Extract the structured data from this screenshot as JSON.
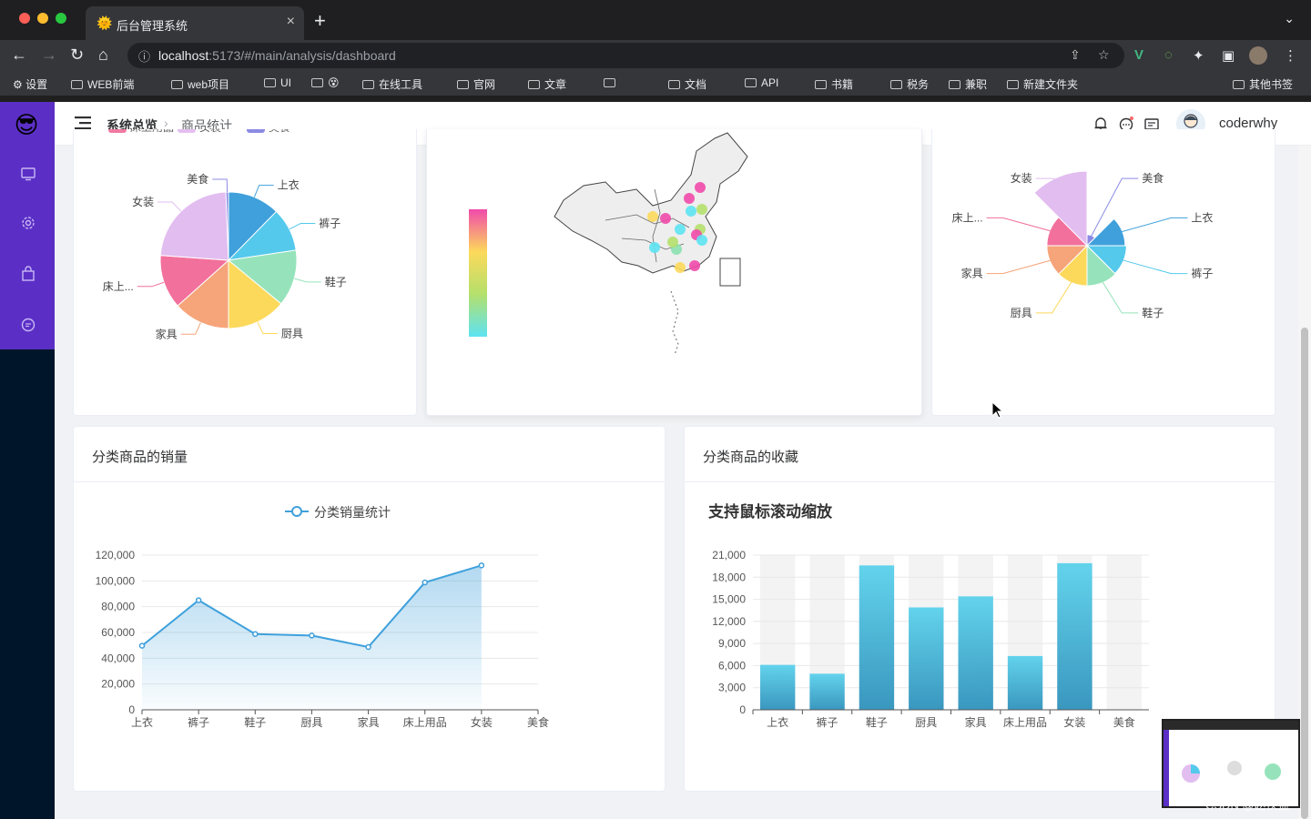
{
  "browser": {
    "tab_title": "后台管理系统",
    "url_host": "localhost",
    "url_rest": ":5173/#/main/analysis/dashboard",
    "bookmarks": [
      "设置",
      "WEB前端",
      "web项目",
      "UI",
      "😵",
      "在线工具",
      "官网",
      "文章",
      "",
      "文档",
      "API",
      "书籍",
      "税务",
      "兼职",
      "新建文件夹"
    ],
    "other_bookmarks": "其他书签"
  },
  "header": {
    "breadcrumb_1": "系统总览",
    "breadcrumb_2": "商品统计",
    "username": "coderwhy"
  },
  "sales_card": {
    "title": "分类商品的销量"
  },
  "favor_card": {
    "title": "分类商品的收藏"
  },
  "watermark": "CSDN @赵侠益",
  "chart_data": [
    {
      "type": "pie",
      "categories": [
        "上衣",
        "裤子",
        "鞋子",
        "厨具",
        "家具",
        "床上...",
        "女装",
        "美食"
      ],
      "values": [
        6000,
        5000,
        6500,
        6800,
        6500,
        6200,
        11300,
        300
      ],
      "legend": [
        "床上用品",
        "女装",
        "美食"
      ],
      "legend_colors": [
        "#f07aa1",
        "#e4bff0",
        "#8b8be5"
      ],
      "colors": [
        "#3fa0db",
        "#54c9ec",
        "#96e3bb",
        "#fcd95b",
        "#f6a47a",
        "#f2709c",
        "#e2bdf0",
        "#8b8be5"
      ]
    },
    {
      "type": "map",
      "visual_map_colors": [
        "#f04aaa",
        "#fcd95b",
        "#b4e06c",
        "#5de3f2"
      ],
      "points": [
        {
          "c": "#f04aaa"
        },
        {
          "c": "#f04aaa"
        },
        {
          "c": "#b4e06c"
        },
        {
          "c": "#5de3f2"
        },
        {
          "c": "#fcd95b"
        },
        {
          "c": "#f04aaa"
        },
        {
          "c": "#5de3f2"
        },
        {
          "c": "#b4e06c"
        },
        {
          "c": "#f04aaa"
        },
        {
          "c": "#5de3f2"
        },
        {
          "c": "#8be0b0"
        },
        {
          "c": "#b4e06c"
        },
        {
          "c": "#5de3f2"
        },
        {
          "c": "#f04aaa"
        },
        {
          "c": "#fcd95b"
        }
      ]
    },
    {
      "type": "rose",
      "categories": [
        "女装",
        "美食",
        "上衣",
        "裤子",
        "鞋子",
        "厨具",
        "家具",
        "床上..."
      ],
      "values": [
        95,
        3,
        42,
        44,
        45,
        45,
        45,
        45
      ],
      "colors": [
        "#e2bdf0",
        "#8b8be5",
        "#3fa0db",
        "#54c9ec",
        "#96e3bb",
        "#fcd95b",
        "#f6a47a",
        "#f2709c"
      ]
    },
    {
      "type": "line",
      "legend": "分类销量统计",
      "categories": [
        "上衣",
        "裤子",
        "鞋子",
        "厨具",
        "家具",
        "床上用品",
        "女装",
        "美食"
      ],
      "values": [
        49700,
        85000,
        58800,
        57600,
        48700,
        98800,
        112000,
        null
      ],
      "yticks": [
        "120,000",
        "100,000",
        "80,000",
        "60,000",
        "40,000",
        "20,000",
        "0"
      ],
      "ylim": [
        0,
        120000
      ],
      "color": "#3fa0db"
    },
    {
      "type": "bar",
      "title": "支持鼠标滚动缩放",
      "categories": [
        "上衣",
        "裤子",
        "鞋子",
        "厨具",
        "家具",
        "床上用品",
        "女装",
        "美食"
      ],
      "values": [
        6100,
        4900,
        19600,
        13900,
        15400,
        7300,
        19900,
        0
      ],
      "yticks": [
        "21,000",
        "18,000",
        "15,000",
        "12,000",
        "9,000",
        "6,000",
        "3,000",
        "0"
      ],
      "ylim": [
        0,
        21000
      ],
      "color": "#4fb9d8"
    }
  ]
}
